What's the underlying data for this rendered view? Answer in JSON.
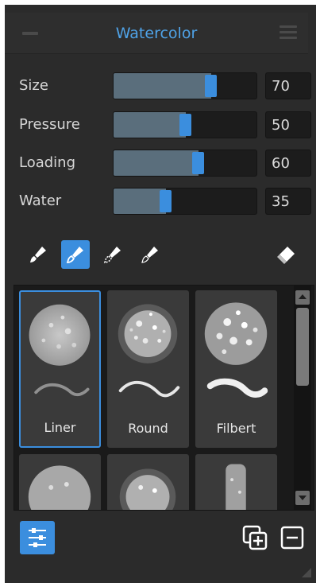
{
  "panel": {
    "title": "Watercolor",
    "accent_color": "#3b8ede",
    "title_color": "#4fa3e8"
  },
  "sliders": [
    {
      "label": "Size",
      "value": "70",
      "fraction": 0.7
    },
    {
      "label": "Pressure",
      "value": "50",
      "fraction": 0.5
    },
    {
      "label": "Loading",
      "value": "60",
      "fraction": 0.6
    },
    {
      "label": "Water",
      "value": "35",
      "fraction": 0.35
    }
  ],
  "tools": [
    {
      "icon": "brush-solid-icon",
      "active": false
    },
    {
      "icon": "brush-outline-icon",
      "active": true
    },
    {
      "icon": "brush-dotted-icon",
      "active": false
    },
    {
      "icon": "brush-thin-icon",
      "active": false
    },
    {
      "icon": "eraser-icon",
      "active": false
    }
  ],
  "brushes": [
    {
      "name": "Liner",
      "selected": true
    },
    {
      "name": "Round",
      "selected": false
    },
    {
      "name": "Filbert",
      "selected": false
    },
    {
      "name": "",
      "selected": false
    },
    {
      "name": "",
      "selected": false
    },
    {
      "name": "",
      "selected": false
    }
  ],
  "footer": {
    "settings_icon": "sliders-icon",
    "duplicate_icon": "duplicate-add-icon",
    "remove_icon": "remove-icon"
  }
}
